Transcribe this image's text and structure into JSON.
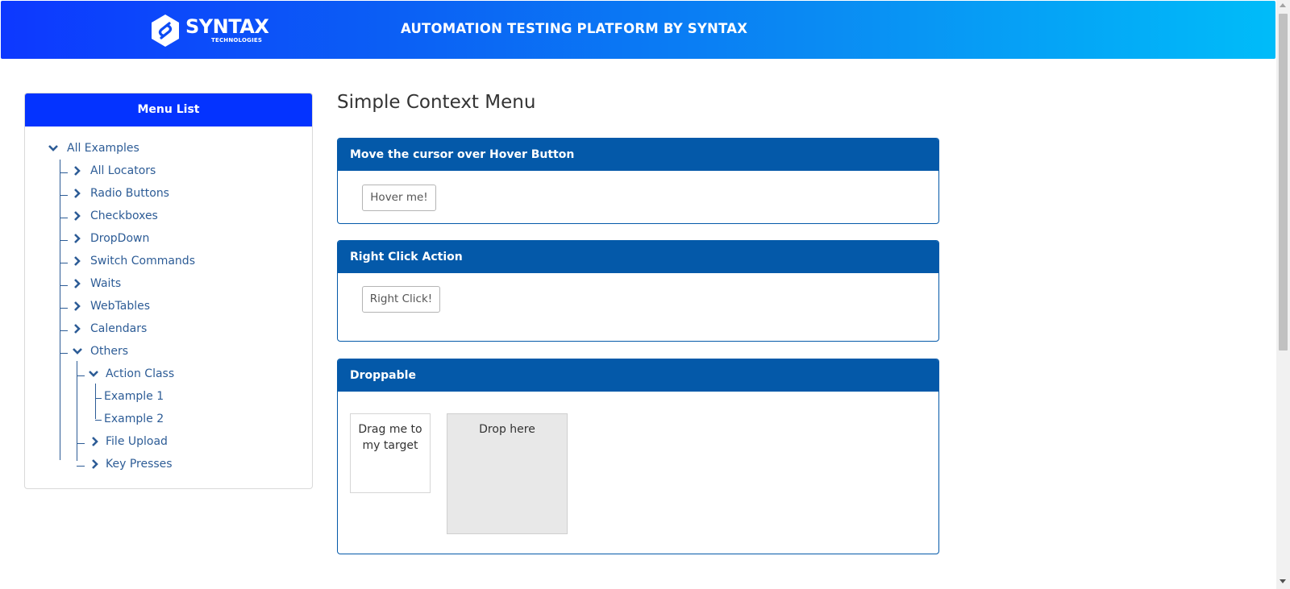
{
  "header": {
    "logo_text": "SYNTAX",
    "logo_subtext": "TECHNOLOGIES",
    "title": "AUTOMATION TESTING PLATFORM BY SYNTAX",
    "gradient_start": "#0d38ff",
    "gradient_end": "#00bcf9"
  },
  "sidebar": {
    "title": "Menu List",
    "header_color": "#0433ff",
    "link_color": "#2d5c96",
    "root": {
      "label": "All Examples",
      "expanded": true
    },
    "items": [
      {
        "label": "All Locators",
        "expanded": false
      },
      {
        "label": "Radio Buttons",
        "expanded": false
      },
      {
        "label": "Checkboxes",
        "expanded": false
      },
      {
        "label": "DropDown",
        "expanded": false
      },
      {
        "label": "Switch Commands",
        "expanded": false
      },
      {
        "label": "Waits",
        "expanded": false
      },
      {
        "label": "WebTables",
        "expanded": false
      },
      {
        "label": "Calendars",
        "expanded": false
      },
      {
        "label": "Others",
        "expanded": true
      }
    ],
    "others_children": [
      {
        "label": "Action Class",
        "expanded": true
      },
      {
        "label": "File Upload",
        "expanded": false
      },
      {
        "label": "Key Presses",
        "expanded": false
      }
    ],
    "action_class_children": [
      {
        "label": "Example 1"
      },
      {
        "label": "Example 2"
      }
    ]
  },
  "main": {
    "title": "Simple Context Menu",
    "card_color": "#0459a9",
    "hover_card": {
      "heading": "Move the cursor over Hover Button",
      "button_label": "Hover me!"
    },
    "right_click_card": {
      "heading": "Right Click Action",
      "button_label": "Right Click!"
    },
    "droppable_card": {
      "heading": "Droppable",
      "drag_label": "Drag me to my target",
      "drop_label": "Drop here"
    }
  }
}
